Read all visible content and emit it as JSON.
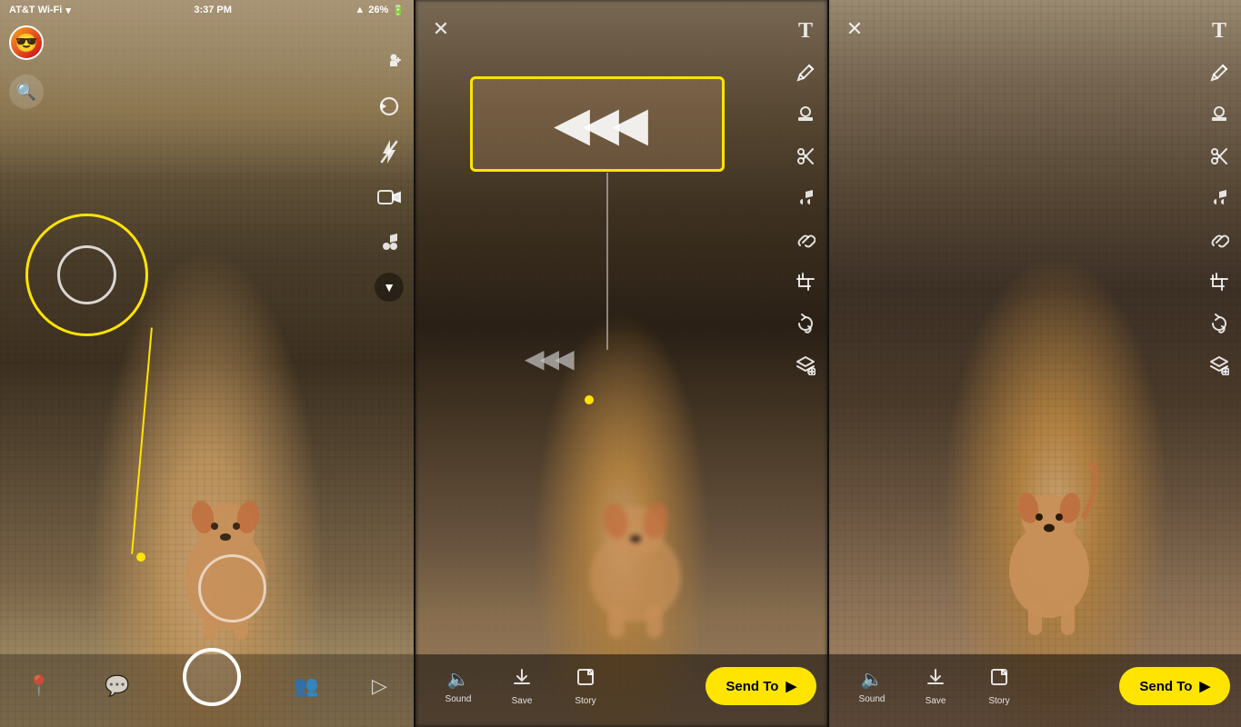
{
  "status": {
    "carrier": "AT&T Wi-Fi",
    "time": "3:37 PM",
    "battery": "26%",
    "location_on": true
  },
  "panel1": {
    "type": "camera",
    "nav_items": [
      {
        "id": "location",
        "icon": "📍",
        "label": ""
      },
      {
        "id": "chat",
        "icon": "💬",
        "label": ""
      },
      {
        "id": "camera",
        "icon": "⬤",
        "label": ""
      },
      {
        "id": "friends",
        "icon": "👥",
        "label": ""
      },
      {
        "id": "stories",
        "icon": "▷",
        "label": ""
      }
    ],
    "toolbar_icons": [
      "add-friend",
      "rotate-camera",
      "flash-off",
      "video-sticker",
      "music",
      "chevron"
    ]
  },
  "panel2": {
    "type": "edit_rewind",
    "close_label": "✕",
    "text_tool": "T",
    "rewind_arrows": "◀◀◀",
    "toolbar_tools": [
      "pencil",
      "stamp",
      "scissors",
      "music-note",
      "paperclip",
      "crop",
      "loop",
      "layers-add"
    ],
    "bottom_actions": [
      {
        "id": "sound",
        "icon": "🔈",
        "label": "Sound"
      },
      {
        "id": "save",
        "icon": "⬇",
        "label": "Save"
      },
      {
        "id": "story",
        "icon": "⊞",
        "label": "Story"
      }
    ],
    "send_to_label": "Send To",
    "send_to_arrow": "▶"
  },
  "panel3": {
    "type": "edit_clean",
    "close_label": "✕",
    "text_tool": "T",
    "toolbar_tools": [
      "pencil",
      "stamp",
      "scissors",
      "music-note",
      "paperclip",
      "crop",
      "loop",
      "layers-add"
    ],
    "bottom_actions": [
      {
        "id": "sound",
        "icon": "🔈",
        "label": "Sound"
      },
      {
        "id": "save",
        "icon": "⬇",
        "label": "Save"
      },
      {
        "id": "story",
        "icon": "⊞",
        "label": "Story"
      }
    ],
    "send_to_label": "Send To",
    "send_to_arrow": "▶"
  },
  "labels": {
    "sound_p2": "Sound",
    "save_p2": "Save",
    "story_p2": "Story",
    "sound_p3": "Sound",
    "save_p3": "Save",
    "story_p3": "Story",
    "send_to_p2": "Send To",
    "send_to_p3": "Send To"
  }
}
